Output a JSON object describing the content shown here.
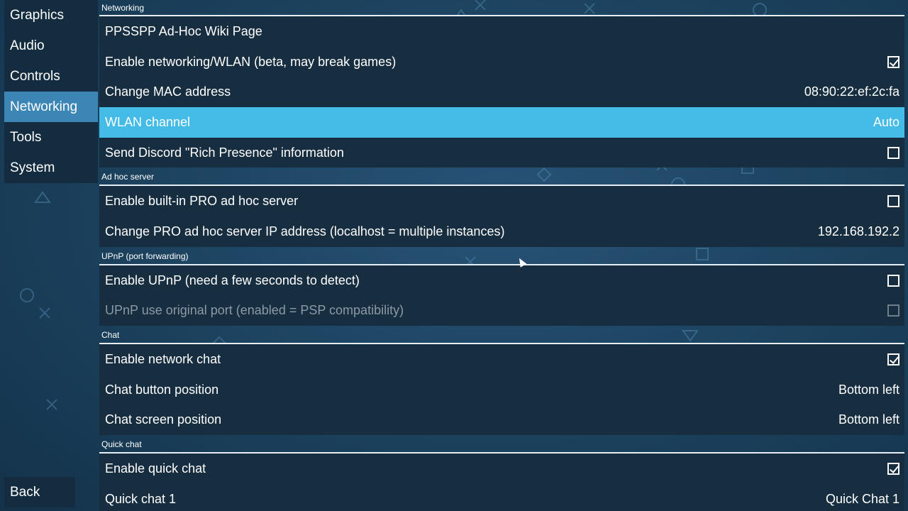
{
  "sidebar": {
    "items": [
      {
        "label": "Graphics"
      },
      {
        "label": "Audio"
      },
      {
        "label": "Controls"
      },
      {
        "label": "Networking"
      },
      {
        "label": "Tools"
      },
      {
        "label": "System"
      }
    ],
    "back_label": "Back"
  },
  "sections": {
    "networking": {
      "title": "Networking",
      "adhoc_wiki": "PPSSPP Ad-Hoc Wiki Page",
      "enable_networking": "Enable networking/WLAN (beta, may break games)",
      "enable_networking_checked": true,
      "change_mac": "Change MAC address",
      "mac_value": "08:90:22:ef:2c:fa",
      "wlan_channel": "WLAN channel",
      "wlan_channel_value": "Auto",
      "discord": "Send Discord \"Rich Presence\" information",
      "discord_checked": false
    },
    "adhoc_server": {
      "title": "Ad hoc server",
      "enable_pro": "Enable built-in PRO ad hoc server",
      "enable_pro_checked": false,
      "change_ip": "Change PRO ad hoc server IP address (localhost = multiple instances)",
      "ip_value": "192.168.192.2"
    },
    "upnp": {
      "title": "UPnP (port forwarding)",
      "enable_upnp": "Enable UPnP (need a few seconds to detect)",
      "enable_upnp_checked": false,
      "original_port": "UPnP use original port (enabled = PSP compatibility)",
      "original_port_checked": false
    },
    "chat": {
      "title": "Chat",
      "enable_chat": "Enable network chat",
      "enable_chat_checked": true,
      "button_position": "Chat button position",
      "button_position_value": "Bottom left",
      "screen_position": "Chat screen position",
      "screen_position_value": "Bottom left"
    },
    "quick_chat": {
      "title": "Quick chat",
      "enable_quick": "Enable quick chat",
      "enable_quick_checked": true,
      "quick_chat_1": "Quick chat 1",
      "quick_chat_1_value": "Quick Chat 1"
    }
  },
  "colors": {
    "selected_row": "#45bbe8",
    "active_tab": "#3c86b5",
    "row_bg": "#172e41"
  }
}
